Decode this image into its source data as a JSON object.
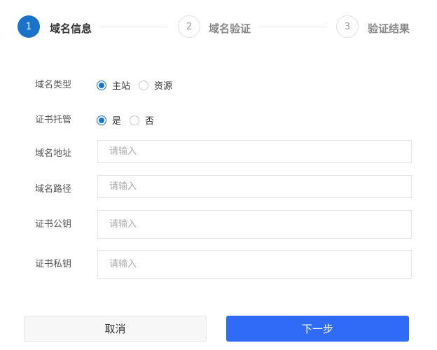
{
  "steps": [
    {
      "number": "1",
      "label": "域名信息",
      "state": "active"
    },
    {
      "number": "2",
      "label": "域名验证",
      "state": "inactive"
    },
    {
      "number": "3",
      "label": "验证结果",
      "state": "inactive"
    }
  ],
  "form": {
    "domain_type": {
      "label": "域名类型",
      "options": [
        {
          "label": "主站",
          "checked": true
        },
        {
          "label": "资源",
          "checked": false
        }
      ]
    },
    "cert_hosting": {
      "label": "证书托管",
      "options": [
        {
          "label": "是",
          "checked": true
        },
        {
          "label": "否",
          "checked": false
        }
      ]
    },
    "domain_address": {
      "label": "域名地址",
      "value": "",
      "placeholder": "请输入"
    },
    "domain_path": {
      "label": "域名路径",
      "value": "",
      "placeholder": "请输入"
    },
    "cert_public_key": {
      "label": "证书公钥",
      "value": "",
      "placeholder": "请输入"
    },
    "cert_private_key": {
      "label": "证书私钥",
      "value": "",
      "placeholder": "请输入"
    }
  },
  "buttons": {
    "cancel": "取消",
    "next": "下一步"
  },
  "colors": {
    "primary": "#1a73c8",
    "button_primary": "#2f6bf6"
  }
}
